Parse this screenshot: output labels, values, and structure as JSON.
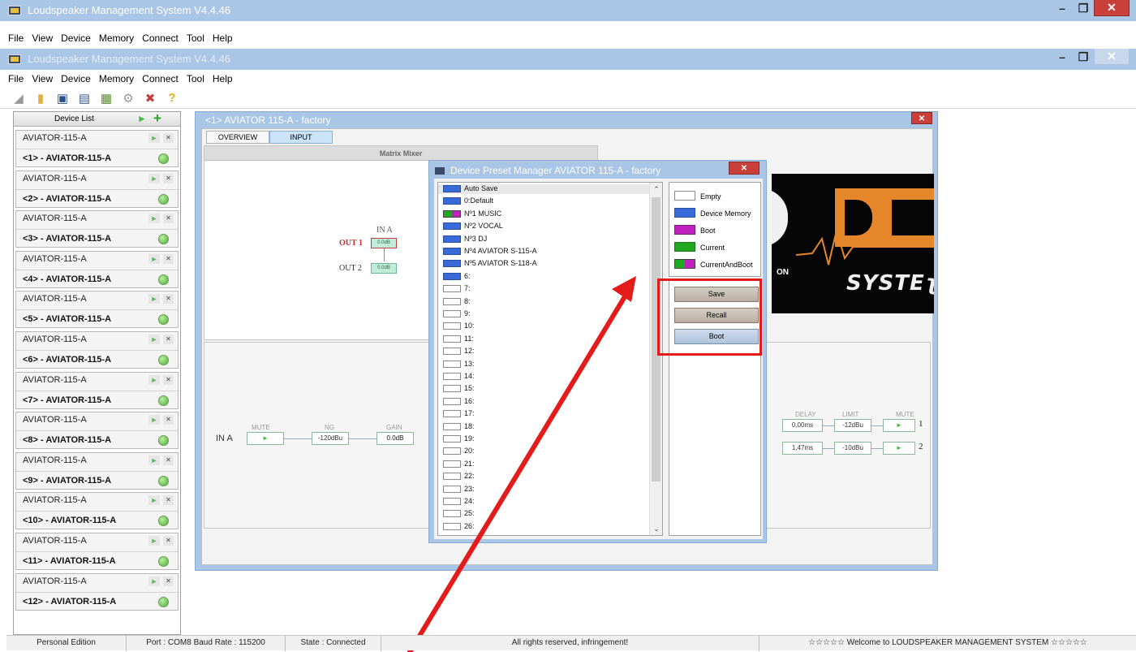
{
  "app": {
    "title": "Loudspeaker Management System V4.4.46",
    "menu": [
      "File",
      "View",
      "Device",
      "Memory",
      "Connect",
      "Tool",
      "Help"
    ]
  },
  "toolbar": {
    "icons": [
      "speaker-dropdown-icon",
      "open-folder-icon",
      "save-disk-icon",
      "print-icon",
      "chip-icon",
      "gear-icon",
      "tools-icon",
      "help-icon"
    ]
  },
  "device_list": {
    "header": "Device List",
    "items": [
      {
        "model": "AVIATOR-115-A",
        "name": "<1> - AVIATOR-115-A"
      },
      {
        "model": "AVIATOR-115-A",
        "name": "<2> - AVIATOR-115-A"
      },
      {
        "model": "AVIATOR-115-A",
        "name": "<3> - AVIATOR-115-A"
      },
      {
        "model": "AVIATOR-115-A",
        "name": "<4> - AVIATOR-115-A"
      },
      {
        "model": "AVIATOR-115-A",
        "name": "<5> - AVIATOR-115-A"
      },
      {
        "model": "AVIATOR-115-A",
        "name": "<6> - AVIATOR-115-A"
      },
      {
        "model": "AVIATOR-115-A",
        "name": "<7> - AVIATOR-115-A"
      },
      {
        "model": "AVIATOR-115-A",
        "name": "<8> - AVIATOR-115-A"
      },
      {
        "model": "AVIATOR-115-A",
        "name": "<9> - AVIATOR-115-A"
      },
      {
        "model": "AVIATOR-115-A",
        "name": "<10> - AVIATOR-115-A"
      },
      {
        "model": "AVIATOR-115-A",
        "name": "<11> - AVIATOR-115-A"
      },
      {
        "model": "AVIATOR-115-A",
        "name": "<12> - AVIATOR-115-A"
      }
    ]
  },
  "device_window": {
    "title": "<1> AVIATOR 115-A - factory",
    "tabs": [
      "OVERVIEW",
      "INPUT"
    ],
    "active_tab": "INPUT",
    "mixer": {
      "header": "Matrix Mixer",
      "input_label": "IN A",
      "out1_label": "OUT 1",
      "out2_label": "OUT 2",
      "out1_gain": "0.0dB",
      "out2_gain": "0.0dB"
    },
    "logo": {
      "text1": "ON",
      "text2": "SYSTEʅ"
    },
    "chain": {
      "input_label": "IN A",
      "mute_label": "MUTE",
      "ng_label": "NG",
      "ng_value": "-120dBu",
      "gain_label": "GAIN",
      "gain_value": "0.0dB",
      "delay_label": "DELAY",
      "limit_label": "LIMIT",
      "out_mute_label": "MUTE",
      "outputs": [
        {
          "delay": "0,00ms",
          "limit": "-12dBu",
          "num": "1"
        },
        {
          "delay": "1,47ms",
          "limit": "-10dBu",
          "num": "2"
        }
      ]
    }
  },
  "preset_manager": {
    "title": "Device Preset Manager  AVIATOR 115-A - factory",
    "presets": [
      {
        "label": "Auto Save",
        "swatch": "blue"
      },
      {
        "label": "0:Default",
        "swatch": "blue"
      },
      {
        "label": "Nº1 MUSIC",
        "swatch": "split"
      },
      {
        "label": "Nº2 VOCAL",
        "swatch": "blue"
      },
      {
        "label": "Nº3 DJ",
        "swatch": "blue"
      },
      {
        "label": "Nº4 AVIATOR S-115-A",
        "swatch": "blue"
      },
      {
        "label": "Nº5 AVIATOR S-118-A",
        "swatch": "blue"
      },
      {
        "label": "6:",
        "swatch": "blue"
      },
      {
        "label": "7:",
        "swatch": "empty"
      },
      {
        "label": "8:",
        "swatch": "empty"
      },
      {
        "label": "9:",
        "swatch": "empty"
      },
      {
        "label": "10:",
        "swatch": "empty"
      },
      {
        "label": "11:",
        "swatch": "empty"
      },
      {
        "label": "12:",
        "swatch": "empty"
      },
      {
        "label": "13:",
        "swatch": "empty"
      },
      {
        "label": "14:",
        "swatch": "empty"
      },
      {
        "label": "15:",
        "swatch": "empty"
      },
      {
        "label": "16:",
        "swatch": "empty"
      },
      {
        "label": "17:",
        "swatch": "empty"
      },
      {
        "label": "18:",
        "swatch": "empty"
      },
      {
        "label": "19:",
        "swatch": "empty"
      },
      {
        "label": "20:",
        "swatch": "empty"
      },
      {
        "label": "21:",
        "swatch": "empty"
      },
      {
        "label": "22:",
        "swatch": "empty"
      },
      {
        "label": "23:",
        "swatch": "empty"
      },
      {
        "label": "24:",
        "swatch": "empty"
      },
      {
        "label": "25:",
        "swatch": "empty"
      },
      {
        "label": "26:",
        "swatch": "empty"
      }
    ],
    "legend": [
      {
        "label": "Empty",
        "swatch": "empty"
      },
      {
        "label": "Device Memory",
        "swatch": "blue"
      },
      {
        "label": "Boot",
        "swatch": "magenta"
      },
      {
        "label": "Current",
        "swatch": "green"
      },
      {
        "label": "CurrentAndBoot",
        "swatch": "split"
      }
    ],
    "buttons": {
      "save": "Save",
      "recall": "Recall",
      "boot": "Boot"
    }
  },
  "status_bar": {
    "edition": "Personal Edition",
    "port": "Port : COM8  Baud Rate : 115200",
    "state": "State : Connected",
    "rights": "All rights reserved, infringement!",
    "welcome": "☆☆☆☆☆ Welcome to LOUDSPEAKER MANAGEMENT SYSTEM ☆☆☆☆☆"
  },
  "colors": {
    "titlebar": "#a9c6e6",
    "close_red": "#c9403a",
    "annotation_red": "#e31b1b",
    "memory_blue": "#3a6ad8",
    "boot_magenta": "#c020c0",
    "current_green": "#20a820",
    "logo_orange": "#e6862a"
  }
}
